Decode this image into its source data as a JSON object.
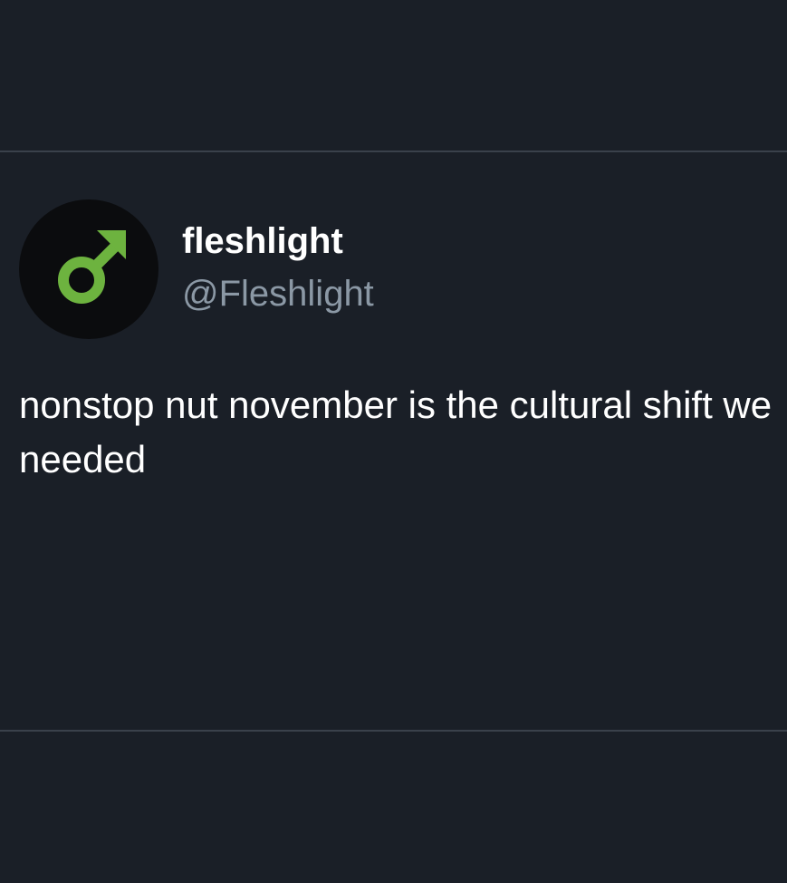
{
  "tweet": {
    "author": {
      "display_name": "fleshlight",
      "handle": "@Fleshlight",
      "avatar_icon": "male-symbol-icon",
      "avatar_icon_color": "#6db33f"
    },
    "text": "nonstop nut november is the cultural shift we needed"
  },
  "colors": {
    "background": "#1a1f27",
    "divider": "#3a414b",
    "primary_text": "#ffffff",
    "secondary_text": "#8b98a5"
  }
}
